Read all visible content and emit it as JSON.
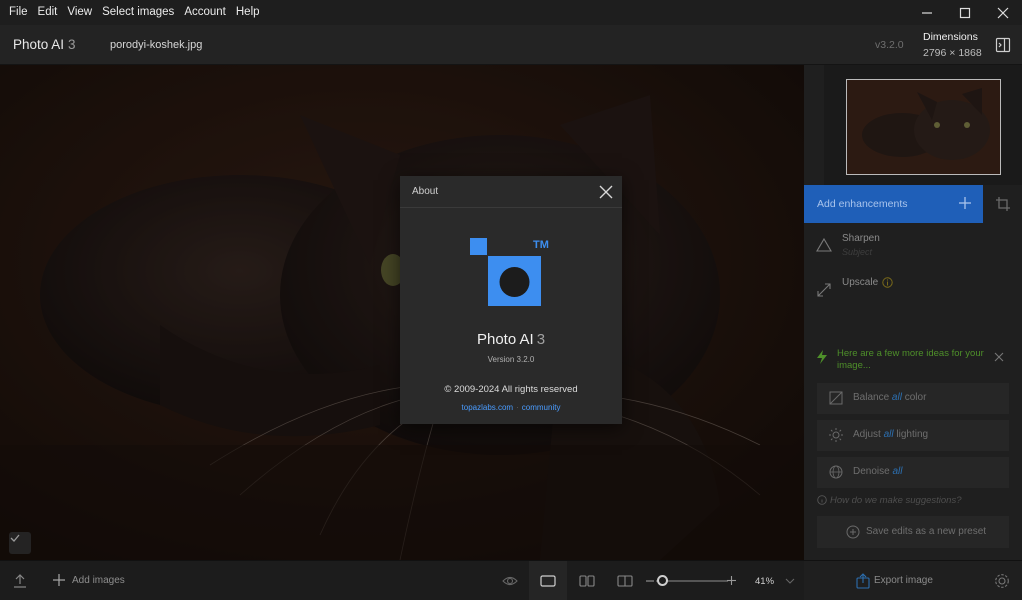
{
  "menu": {
    "items": [
      "File",
      "Edit",
      "View",
      "Select images",
      "Account",
      "Help"
    ]
  },
  "header": {
    "app_name": "Photo AI",
    "app_version_major": "3",
    "filename": "porodyi-koshek.jpg",
    "version": "v3.2.0",
    "dimensions_label": "Dimensions",
    "dimensions_value": "2796 × 1868"
  },
  "about_dialog": {
    "title": "About",
    "trademark": "TM",
    "app_name": "Photo AI",
    "app_version_major": "3",
    "version_line": "Version 3.2.0",
    "copyright": "© 2009-2024 All rights reserved",
    "link_site": "topazlabs.com",
    "link_community": "community",
    "brand_color": "#3d8ef0"
  },
  "panel": {
    "add_enhancements": "Add enhancements",
    "enhancements": [
      {
        "name": "Sharpen",
        "sub": "Subject",
        "icon": "triangle-icon"
      },
      {
        "name": "Upscale",
        "sub": "",
        "icon": "expand-arrow-icon"
      }
    ],
    "ideas_title": "Here are a few more ideas for your image...",
    "ideas": [
      {
        "prefix": "Balance",
        "em": "all",
        "suffix": "color",
        "icon": "balance-icon"
      },
      {
        "prefix": "Adjust",
        "em": "all",
        "suffix": "lighting",
        "icon": "sun-icon"
      },
      {
        "prefix": "Denoise",
        "em": "all",
        "suffix": "",
        "icon": "denoise-icon"
      }
    ],
    "how_suggestions": "How do we make suggestions?",
    "save_preset": "Save edits as a new preset"
  },
  "bottom": {
    "add_images": "Add images",
    "zoom": "41%",
    "export": "Export image"
  },
  "colors": {
    "accent": "#1f5fb8",
    "link": "#4a9cff",
    "ideas_green": "#4e8f2a"
  }
}
